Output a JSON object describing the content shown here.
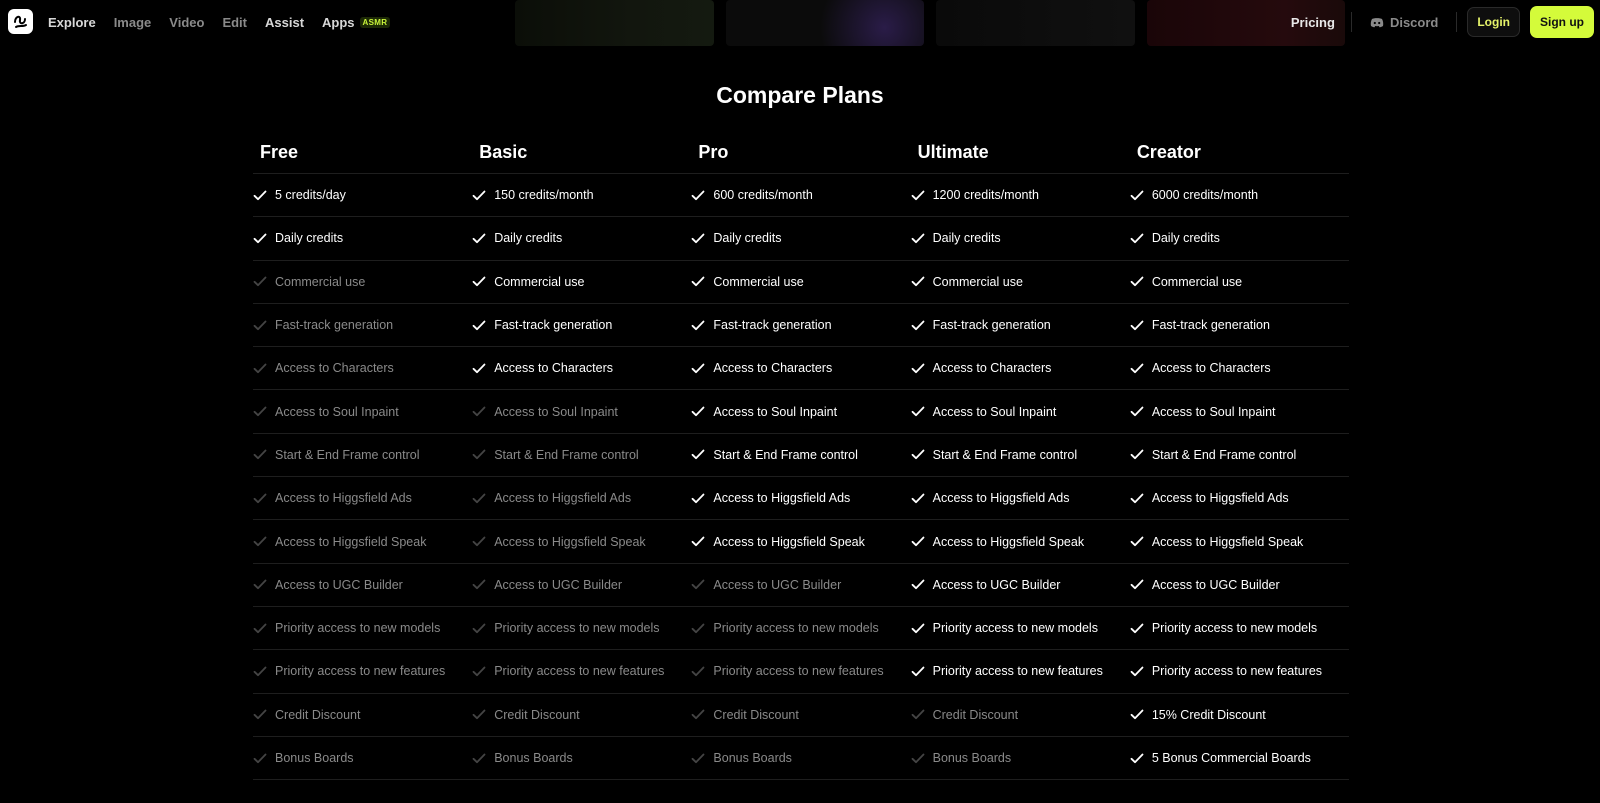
{
  "nav": {
    "items": [
      "Explore",
      "Image",
      "Video",
      "Edit",
      "Assist",
      "Apps"
    ],
    "apps_badge": "ASMR",
    "pricing": "Pricing",
    "discord": "Discord",
    "login": "Login",
    "signup": "Sign up"
  },
  "section_title": "Compare Plans",
  "plans": [
    "Free",
    "Basic",
    "Pro",
    "Ultimate",
    "Creator"
  ],
  "rows": [
    [
      [
        "5 credits/day",
        true
      ],
      [
        "150 credits/month",
        true
      ],
      [
        "600 credits/month",
        true
      ],
      [
        "1200 credits/month",
        true
      ],
      [
        "6000 credits/month",
        true
      ]
    ],
    [
      [
        "Daily credits",
        true
      ],
      [
        "Daily credits",
        true
      ],
      [
        "Daily credits",
        true
      ],
      [
        "Daily credits",
        true
      ],
      [
        "Daily credits",
        true
      ]
    ],
    [
      [
        "Commercial use",
        false
      ],
      [
        "Commercial use",
        true
      ],
      [
        "Commercial use",
        true
      ],
      [
        "Commercial use",
        true
      ],
      [
        "Commercial use",
        true
      ]
    ],
    [
      [
        "Fast-track generation",
        false
      ],
      [
        "Fast-track generation",
        true
      ],
      [
        "Fast-track generation",
        true
      ],
      [
        "Fast-track generation",
        true
      ],
      [
        "Fast-track generation",
        true
      ]
    ],
    [
      [
        "Access to Characters",
        false
      ],
      [
        "Access to Characters",
        true
      ],
      [
        "Access to Characters",
        true
      ],
      [
        "Access to Characters",
        true
      ],
      [
        "Access to Characters",
        true
      ]
    ],
    [
      [
        "Access to Soul Inpaint",
        false
      ],
      [
        "Access to Soul Inpaint",
        false
      ],
      [
        "Access to Soul Inpaint",
        true
      ],
      [
        "Access to Soul Inpaint",
        true
      ],
      [
        "Access to Soul Inpaint",
        true
      ]
    ],
    [
      [
        "Start & End Frame control",
        false
      ],
      [
        "Start & End Frame control",
        false
      ],
      [
        "Start & End Frame control",
        true
      ],
      [
        "Start & End Frame control",
        true
      ],
      [
        "Start & End Frame control",
        true
      ]
    ],
    [
      [
        "Access to Higgsfield Ads",
        false
      ],
      [
        "Access to Higgsfield Ads",
        false
      ],
      [
        "Access to Higgsfield Ads",
        true
      ],
      [
        "Access to Higgsfield Ads",
        true
      ],
      [
        "Access to Higgsfield Ads",
        true
      ]
    ],
    [
      [
        "Access to Higgsfield Speak",
        false
      ],
      [
        "Access to Higgsfield Speak",
        false
      ],
      [
        "Access to Higgsfield Speak",
        true
      ],
      [
        "Access to Higgsfield Speak",
        true
      ],
      [
        "Access to Higgsfield Speak",
        true
      ]
    ],
    [
      [
        "Access to UGC Builder",
        false
      ],
      [
        "Access to UGC Builder",
        false
      ],
      [
        "Access to UGC Builder",
        false
      ],
      [
        "Access to UGC Builder",
        true
      ],
      [
        "Access to UGC Builder",
        true
      ]
    ],
    [
      [
        "Priority access to new models",
        false
      ],
      [
        "Priority access to new models",
        false
      ],
      [
        "Priority access to new models",
        false
      ],
      [
        "Priority access to new models",
        true
      ],
      [
        "Priority access to new models",
        true
      ]
    ],
    [
      [
        "Priority access to new features",
        false
      ],
      [
        "Priority access to new features",
        false
      ],
      [
        "Priority access to new features",
        false
      ],
      [
        "Priority access to new features",
        true
      ],
      [
        "Priority access to new features",
        true
      ]
    ],
    [
      [
        "Credit Discount",
        false
      ],
      [
        "Credit Discount",
        false
      ],
      [
        "Credit Discount",
        false
      ],
      [
        "Credit Discount",
        false
      ],
      [
        "15% Credit Discount",
        true
      ]
    ],
    [
      [
        "Bonus Boards",
        false
      ],
      [
        "Bonus Boards",
        false
      ],
      [
        "Bonus Boards",
        false
      ],
      [
        "Bonus Boards",
        false
      ],
      [
        "5 Bonus Commercial Boards",
        true
      ]
    ]
  ],
  "colors": {
    "accent": "#d4fb3a",
    "enabled_text": "#ffffff",
    "disabled_text": "#8a8a8a"
  }
}
